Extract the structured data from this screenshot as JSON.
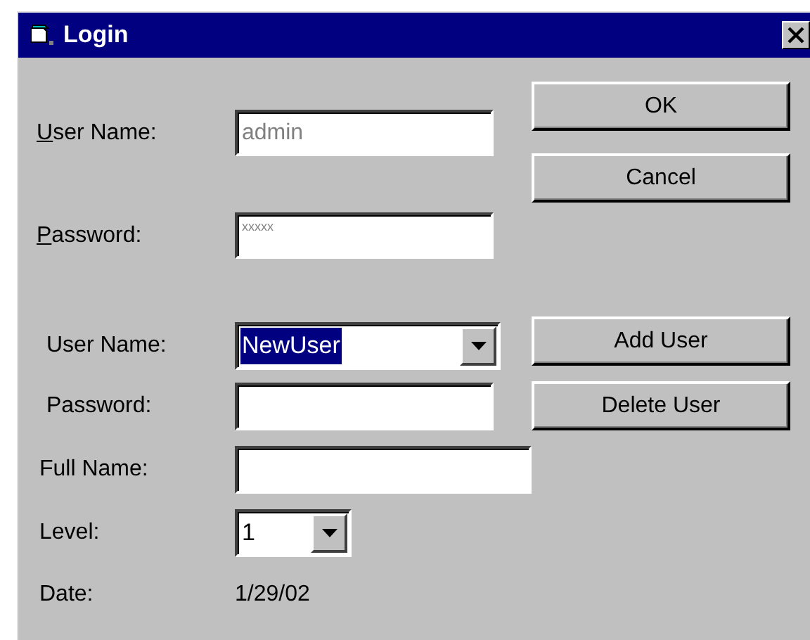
{
  "window": {
    "title": "Login"
  },
  "login": {
    "fields": [
      {
        "label": "User Name:",
        "mnemonic": true,
        "value": "admin",
        "disabled": true
      },
      {
        "label": "Password:",
        "mnemonic": true,
        "value": "xxxxx",
        "disabled": true,
        "masked": true
      }
    ],
    "buttons": [
      {
        "label": "OK"
      },
      {
        "label": "Cancel"
      }
    ]
  },
  "user_editor": {
    "fields": [
      {
        "kind": "combo",
        "label": "User Name:",
        "value": "NewUser",
        "highlighted": true
      },
      {
        "kind": "text",
        "label": "Password:"
      },
      {
        "kind": "text",
        "label": "Full Name:"
      },
      {
        "kind": "combo",
        "label": "Level:",
        "value": "1",
        "highlighted": false
      },
      {
        "kind": "static",
        "label": "Date:",
        "value": "1/29/02"
      }
    ],
    "buttons": [
      {
        "label": "Add User"
      },
      {
        "label": "Delete User"
      }
    ]
  }
}
